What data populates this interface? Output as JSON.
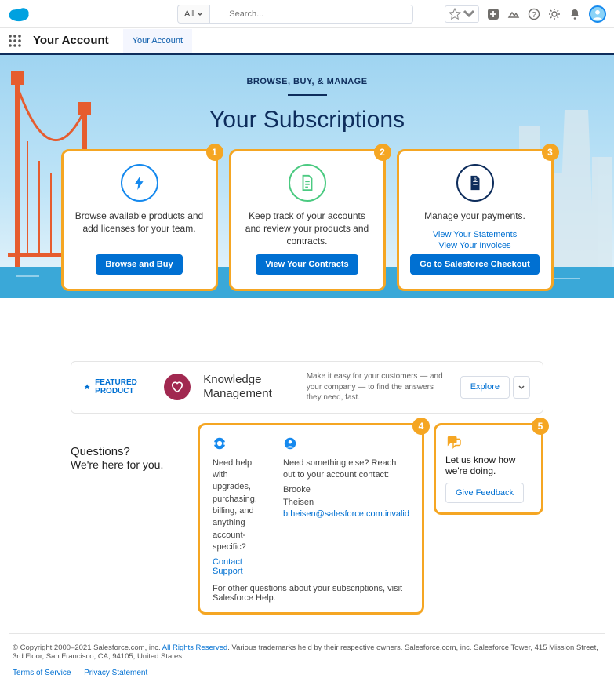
{
  "topbar": {
    "search_scope": "All",
    "search_placeholder": "Search..."
  },
  "navbar": {
    "app_name": "Your Account",
    "tab_label": "Your Account"
  },
  "hero": {
    "eyebrow": "BROWSE, BUY, & MANAGE",
    "title": "Your Subscriptions"
  },
  "cards": [
    {
      "badge": "1",
      "text": "Browse available products and add licenses for your team.",
      "links": [],
      "button": "Browse and Buy"
    },
    {
      "badge": "2",
      "text": "Keep track of your accounts and review your products and contracts.",
      "links": [],
      "button": "View Your Contracts"
    },
    {
      "badge": "3",
      "text": "Manage your payments.",
      "links": [
        "View Your Statements",
        "View Your Invoices"
      ],
      "button": "Go to Salesforce Checkout"
    }
  ],
  "featured": {
    "label": "FEATURED PRODUCT",
    "title": "Knowledge Management",
    "desc": "Make it easy for your customers — and your company — to find the answers they need, fast.",
    "button": "Explore"
  },
  "questions": {
    "heading": "Questions?",
    "sub": "We're here for you."
  },
  "help": {
    "badge": "4",
    "col1_text": "Need help with upgrades, purchasing, billing, and anything account-specific?",
    "col1_link": "Contact Support",
    "col2_text": "Need something else? Reach out to your account contact:",
    "contact_name_first": "Brooke",
    "contact_name_last": "Theisen",
    "contact_email": "btheisen@salesforce.com.invalid",
    "footer_pre": "For other questions about your subscriptions, visit ",
    "footer_link": "Salesforce Help",
    "footer_post": "."
  },
  "feedback": {
    "badge": "5",
    "text": "Let us know how we're doing.",
    "button": "Give Feedback"
  },
  "footer": {
    "copyright_pre": "© Copyright 2000–2021 Salesforce.com, inc. ",
    "rights_link": "All Rights Reserved",
    "copyright_post": ". Various trademarks held by their respective owners. Salesforce.com, inc. Salesforce Tower, 415 Mission Street, 3rd Floor, San Francisco, CA, 94105, United States.",
    "tos": "Terms of Service",
    "privacy": "Privacy Statement"
  }
}
